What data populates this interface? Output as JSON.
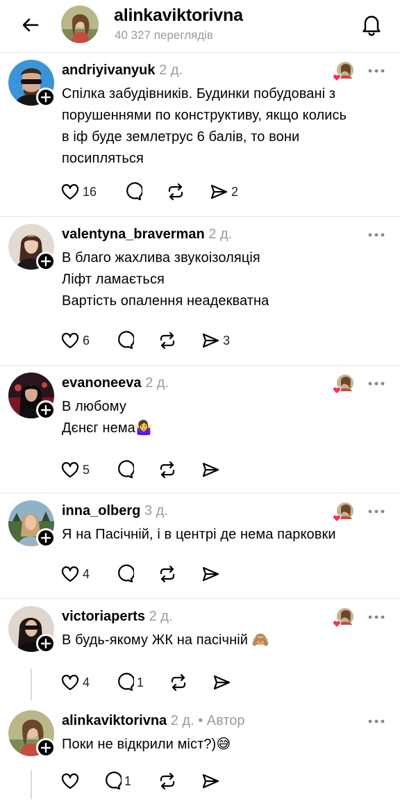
{
  "header": {
    "title": "alinkaviktorivna",
    "views": "40 327 переглядів"
  },
  "posts": [
    {
      "username": "andriyivanyuk",
      "time": "2 д.",
      "lines": [
        "Спілка забудівників. Будинки побудовані з",
        "порушеннями по конструктиву, якщо колись",
        "в іф буде землетрус 6 балів, то вони",
        "посипляться"
      ],
      "likes": "16",
      "replies": "",
      "shares": "2",
      "liked_by_author": true
    },
    {
      "username": "valentyna_braverman",
      "time": "2 д.",
      "lines": [
        "В благо жахлива звукоізоляція",
        "Ліфт ламається",
        "Вартість опалення неадекватна"
      ],
      "likes": "6",
      "replies": "",
      "shares": "3",
      "liked_by_author": false
    },
    {
      "username": "evanoneeva",
      "time": "2 д.",
      "lines": [
        "В любому",
        "Дєнєг нема🤷‍♀️"
      ],
      "likes": "5",
      "replies": "",
      "shares": "",
      "liked_by_author": true
    },
    {
      "username": "inna_olberg",
      "time": "3 д.",
      "lines": [
        "Я на Пасічній, і в центрі де нема парковки"
      ],
      "likes": "4",
      "replies": "",
      "shares": "",
      "liked_by_author": true
    },
    {
      "username": "victoriaperts",
      "time": "2 д.",
      "lines": [
        "В будь-якому ЖК на пасічній 🙈"
      ],
      "likes": "4",
      "replies": "1",
      "shares": "",
      "liked_by_author": true
    },
    {
      "username": "alinkaviktorivna",
      "time": "2 д.",
      "author_tag": "Автор",
      "lines": [
        "Поки не відкрили міст?)😅"
      ],
      "likes": "",
      "replies": "1",
      "shares": "",
      "liked_by_author": false
    }
  ]
}
